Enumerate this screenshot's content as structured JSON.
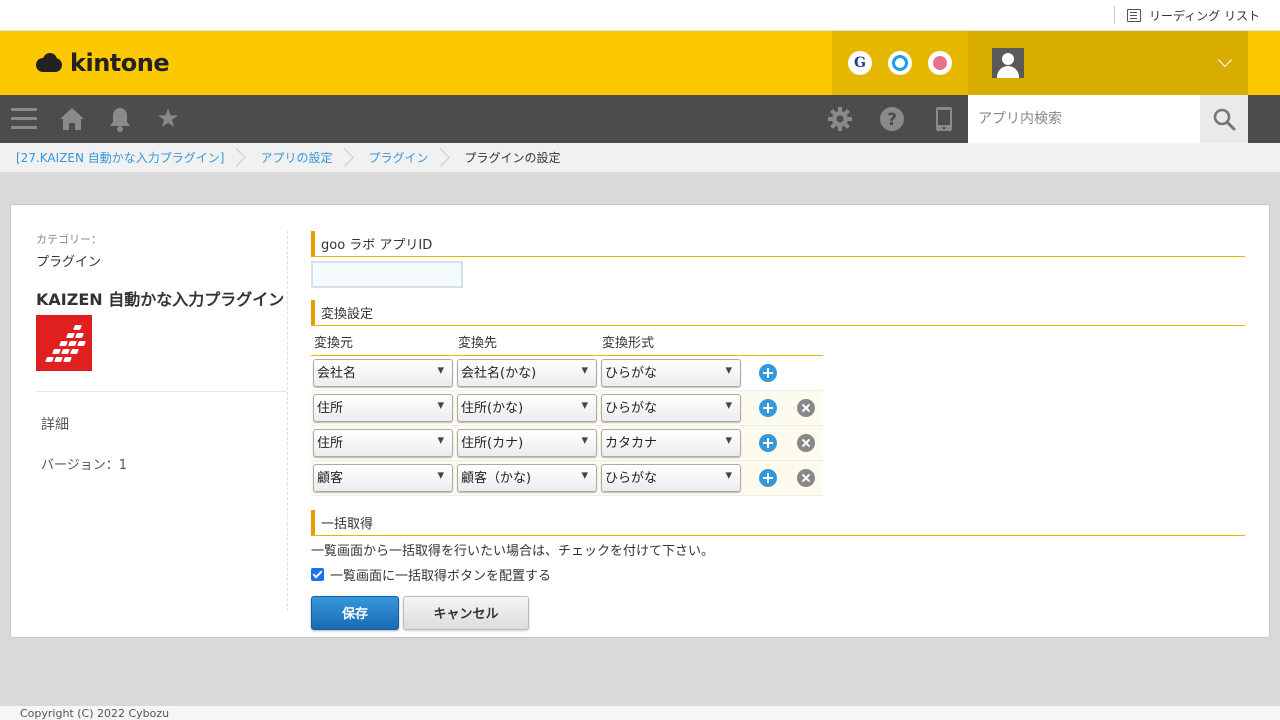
{
  "browser": {
    "reading_list": "リーディング リスト"
  },
  "header": {
    "logo_text": "kintone",
    "apps": [
      {
        "icon": "g-icon",
        "glyph": "G"
      },
      {
        "icon": "circle-icon"
      },
      {
        "icon": "mail-icon"
      }
    ]
  },
  "nav": {
    "search_placeholder": "アプリ内検索"
  },
  "breadcrumb": [
    "[27.KAIZEN 自動かな入力プラグイン]",
    "アプリの設定",
    "プラグイン",
    "プラグインの設定"
  ],
  "sidebar": {
    "category_label": "カテゴリー：",
    "category_value": "プラグイン",
    "plugin_name": "KAIZEN 自動かな入力プラグイン",
    "detail_link": "詳細",
    "version": "バージョン：1"
  },
  "settings": {
    "appid_title": "goo ラボ アプリID",
    "appid_value": "",
    "conversion_title": "変換設定",
    "columns": [
      "変換元",
      "変換先",
      "変換形式"
    ],
    "rows": [
      {
        "source": "会社名",
        "target": "会社名(かな)",
        "format": "ひらがな",
        "deletable": false
      },
      {
        "source": "住所",
        "target": "住所(かな)",
        "format": "ひらがな",
        "deletable": true
      },
      {
        "source": "住所",
        "target": "住所(カナ)",
        "format": "カタカナ",
        "deletable": true
      },
      {
        "source": "顧客",
        "target": "顧客（かな)",
        "format": "ひらがな",
        "deletable": true
      }
    ],
    "bulk_title": "一括取得",
    "bulk_note": "一覧画面から一括取得を行いたい場合は、チェックを付けて下さい。",
    "bulk_checkbox_label": "一覧画面に一括取得ボタンを配置する",
    "bulk_checked": true,
    "save_label": "保存",
    "cancel_label": "キャンセル"
  },
  "footer": {
    "copyright": "Copyright (C) 2022 Cybozu"
  },
  "colors": {
    "header_yellow": "#fcc800",
    "nav_dark": "#4c4c4c",
    "accent_blue": "#3498db",
    "section_orange": "#e5a000"
  }
}
